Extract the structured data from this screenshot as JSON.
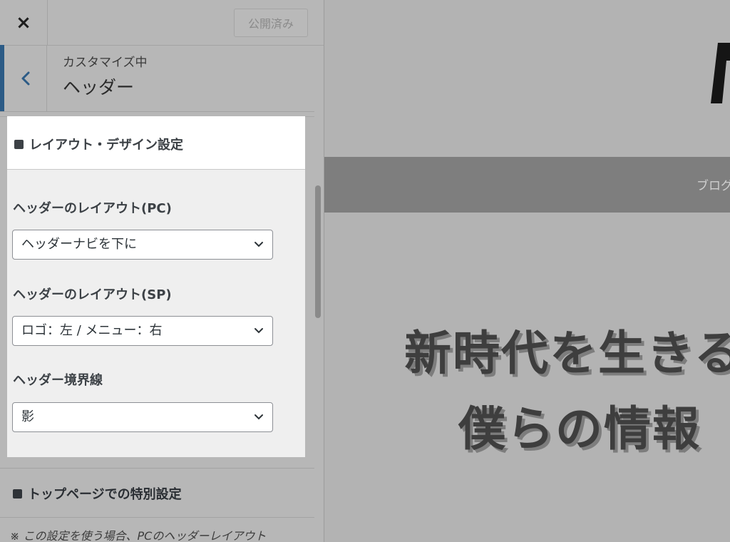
{
  "topbar": {
    "close_label": "×",
    "publish_label": "公開済み"
  },
  "section": {
    "breadcrumb": "カスタマイズ中",
    "title": "ヘッダー"
  },
  "layout_section": {
    "heading": "レイアウト・デザイン設定",
    "fields": [
      {
        "label": "ヘッダーのレイアウト(PC)",
        "value": "ヘッダーナビを下に"
      },
      {
        "label": "ヘッダーのレイアウト(SP)",
        "value": "ロゴ：左 / メニュー：右"
      },
      {
        "label": "ヘッダー境界線",
        "value": "影"
      }
    ]
  },
  "top_page_section": {
    "heading": "トップページでの特別設定",
    "note": "※ この設定を使う場合、PCのヘッダーレイアウト"
  },
  "preview": {
    "nav_item": "ブログ",
    "hero_line1": "新時代を生きる",
    "hero_line2": "僕らの情報"
  },
  "colors": {
    "accent": "#2c5b86",
    "panel": "#efefef",
    "overlay": "#b2b2b2"
  }
}
